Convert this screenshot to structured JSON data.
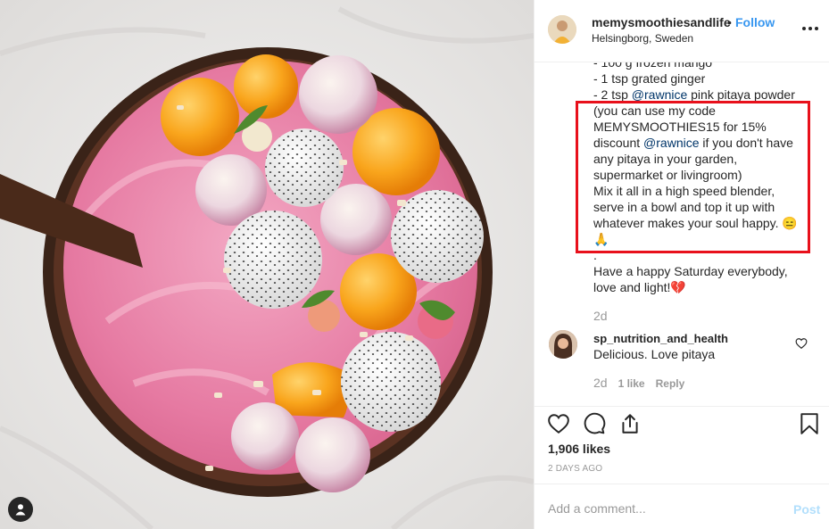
{
  "post": {
    "username": "memysmoothiesandlife",
    "separator": "•",
    "follow_label": "Follow",
    "location": "Helsingborg, Sweden",
    "caption_lines": [
      [
        "- 100 g frozen mango"
      ],
      [
        "- 1 tsp grated ginger"
      ],
      [
        "- 2 tsp ",
        "@rawnice",
        " pink pitaya powder"
      ],
      [
        "(you can use my code"
      ],
      [
        "MEMYSMOOTHIES15 for 15%"
      ],
      [
        "discount ",
        "@rawnice",
        " if you don't have"
      ],
      [
        "any pitaya in your garden,"
      ],
      [
        "supermarket or livingroom)"
      ],
      [
        "Mix it all in a high speed blender,"
      ],
      [
        "serve in a bowl and top it up with"
      ],
      [
        "whatever makes your soul happy. 😑"
      ],
      [
        "🙏"
      ],
      [
        "."
      ],
      [
        "Have a happy Saturday everybody,"
      ],
      [
        "love and light!💔"
      ]
    ],
    "caption_time": "2d",
    "likes": "1,906 likes",
    "posted": "2 DAYS AGO"
  },
  "comment": {
    "username": "sp_nutrition_and_health",
    "text": "Delicious. Love pitaya",
    "time": "2d",
    "likes": "1 like",
    "reply": "Reply"
  },
  "add_comment": {
    "placeholder": "Add a comment...",
    "post_label": "Post"
  },
  "colors": {
    "link": "#3897f0",
    "mention": "#003569",
    "highlight_box": "#e8101b",
    "muted": "#999999"
  },
  "icons": [
    "user-tag-icon",
    "more-options-icon",
    "heart-icon",
    "comment-icon",
    "share-icon",
    "bookmark-icon",
    "comment-heart-icon"
  ]
}
